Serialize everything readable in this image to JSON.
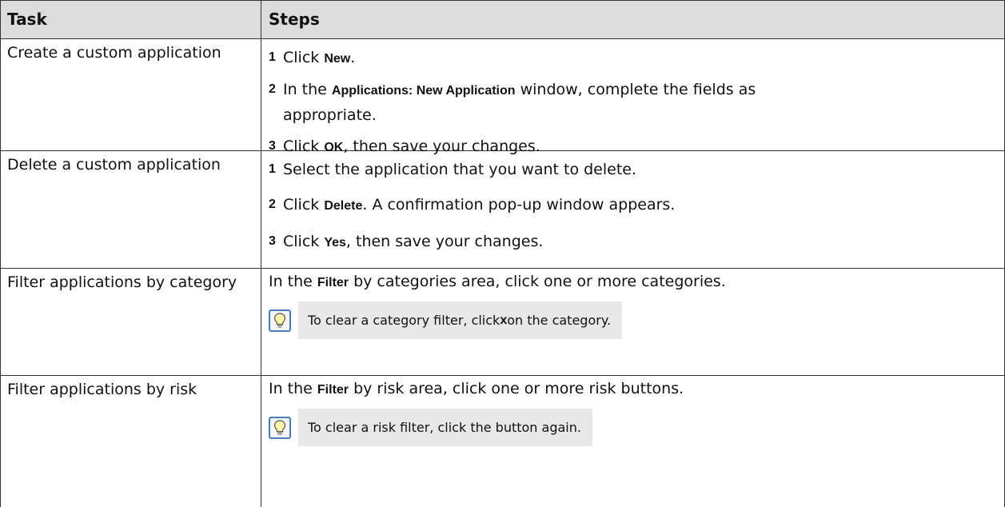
{
  "header": {
    "task": "Task",
    "steps": "Steps"
  },
  "rows": [
    {
      "task": "Create a custom application",
      "steps": [
        {
          "num": "1",
          "pre": "Click ",
          "bold": "New",
          "post": "."
        },
        {
          "num": "2",
          "pre": "In the ",
          "bold": "Applications: New Application",
          "post": " window, complete the fields as",
          "cont": "appropriate."
        },
        {
          "num": "3",
          "pre": "Click ",
          "bold": "OK",
          "post": ", then save your changes."
        }
      ]
    },
    {
      "task": "Delete a custom application",
      "steps": [
        {
          "num": "1",
          "pre": "Select the application that you want to delete.",
          "bold": "",
          "post": ""
        },
        {
          "num": "2",
          "pre": "Click ",
          "bold": "Delete",
          "post": ". A confirmation pop-up window appears."
        },
        {
          "num": "3",
          "pre": "Click ",
          "bold": "Yes",
          "post": ", then save your changes."
        }
      ]
    },
    {
      "task": "Filter applications by category",
      "text": {
        "pre": "In the ",
        "bold": "Filter",
        "post": " by categories area, click one or more categories."
      },
      "tip": {
        "pre": "To clear a category filter, click ",
        "bold": "x",
        "post": " on the category."
      }
    },
    {
      "task": "Filter applications by risk",
      "text": {
        "pre": "In the ",
        "bold": "Filter",
        "post": " by risk area, click one or more risk buttons."
      },
      "tip": {
        "pre": "To clear a risk filter, click the button again.",
        "bold": "",
        "post": ""
      }
    }
  ],
  "icons": {
    "tip": "lightbulb-icon"
  }
}
